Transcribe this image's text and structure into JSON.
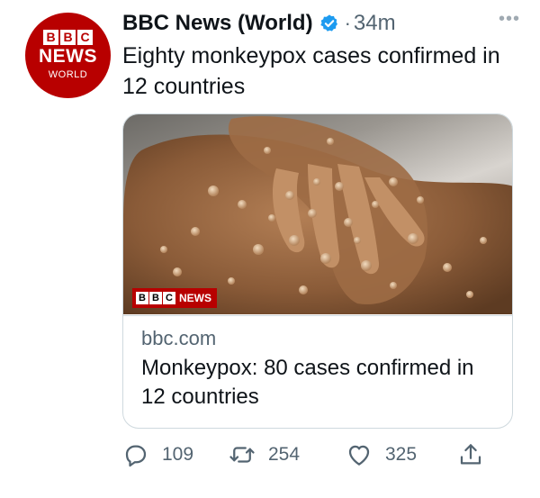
{
  "author": {
    "display_name": "BBC News (World)",
    "verified": true,
    "separator": "·",
    "time": "34m",
    "avatar": {
      "bbc": [
        "B",
        "B",
        "C"
      ],
      "line1": "NEWS",
      "line2": "WORLD"
    }
  },
  "more_icon": "more-horizontal-icon",
  "tweet": {
    "text": "Eighty monkeypox cases confirmed in 12 countries"
  },
  "card": {
    "image_watermark": {
      "bbc": [
        "B",
        "B",
        "C"
      ],
      "label": "NEWS"
    },
    "domain": "bbc.com",
    "title": "Monkeypox: 80 cases confirmed in 12 countries"
  },
  "actions": {
    "reply": {
      "icon": "reply-icon",
      "count": "109"
    },
    "retweet": {
      "icon": "retweet-icon",
      "count": "254"
    },
    "like": {
      "icon": "heart-icon",
      "count": "325"
    },
    "share": {
      "icon": "share-icon"
    }
  },
  "colors": {
    "brand_red": "#b80000",
    "verified_blue": "#1d9bf0",
    "muted_text": "#536471"
  }
}
